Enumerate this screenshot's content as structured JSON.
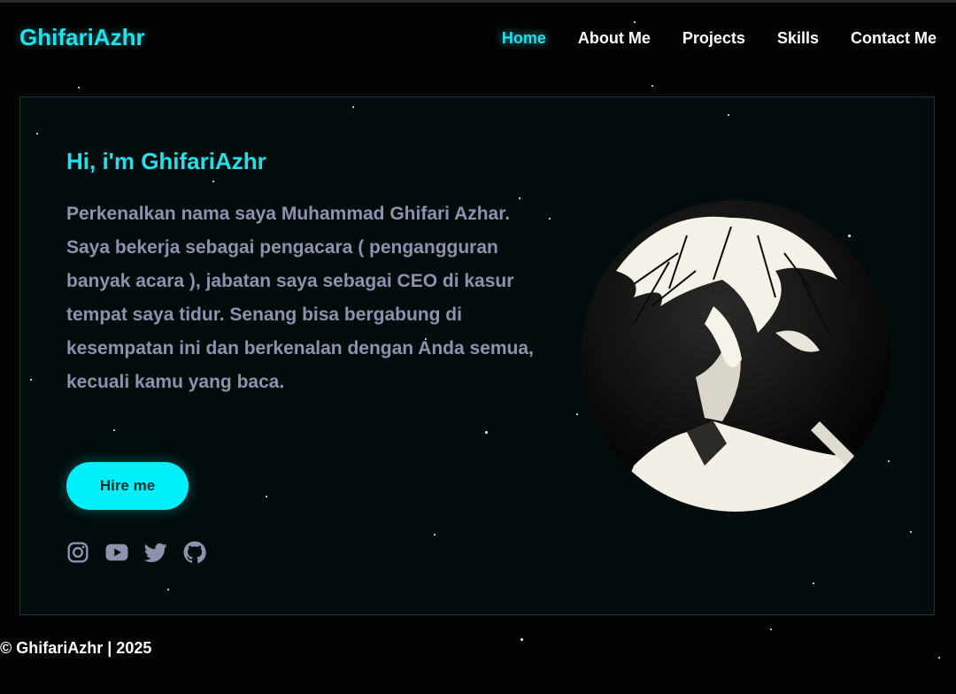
{
  "header": {
    "logo": "GhifariAzhr",
    "nav": [
      {
        "label": "Home",
        "active": true
      },
      {
        "label": "About Me",
        "active": false
      },
      {
        "label": "Projects",
        "active": false
      },
      {
        "label": "Skills",
        "active": false
      },
      {
        "label": "Contact Me",
        "active": false
      }
    ]
  },
  "hero": {
    "greeting": "Hi, i'm GhifariAzhr",
    "intro": "Perkenalkan nama saya Muhammad Ghifari Azhar. Saya bekerja sebagai pengacara ( pengangguran banyak acara ), jabatan saya sebagai CEO di kasur tempat saya tidur. Senang bisa bergabung di kesempatan ini dan berkenalan dengan Anda semua, kecuali kamu yang baca.",
    "hire_label": "Hire me",
    "socials": [
      "instagram-icon",
      "youtube-icon",
      "twitter-icon",
      "github-icon"
    ]
  },
  "footer": {
    "copyright": "© GhifariAzhr | 2025"
  },
  "colors": {
    "accent": "#22e1ec",
    "button": "#00eff8",
    "body_text": "#8c93ad",
    "background": "#030303",
    "panel": "#020c0c"
  }
}
